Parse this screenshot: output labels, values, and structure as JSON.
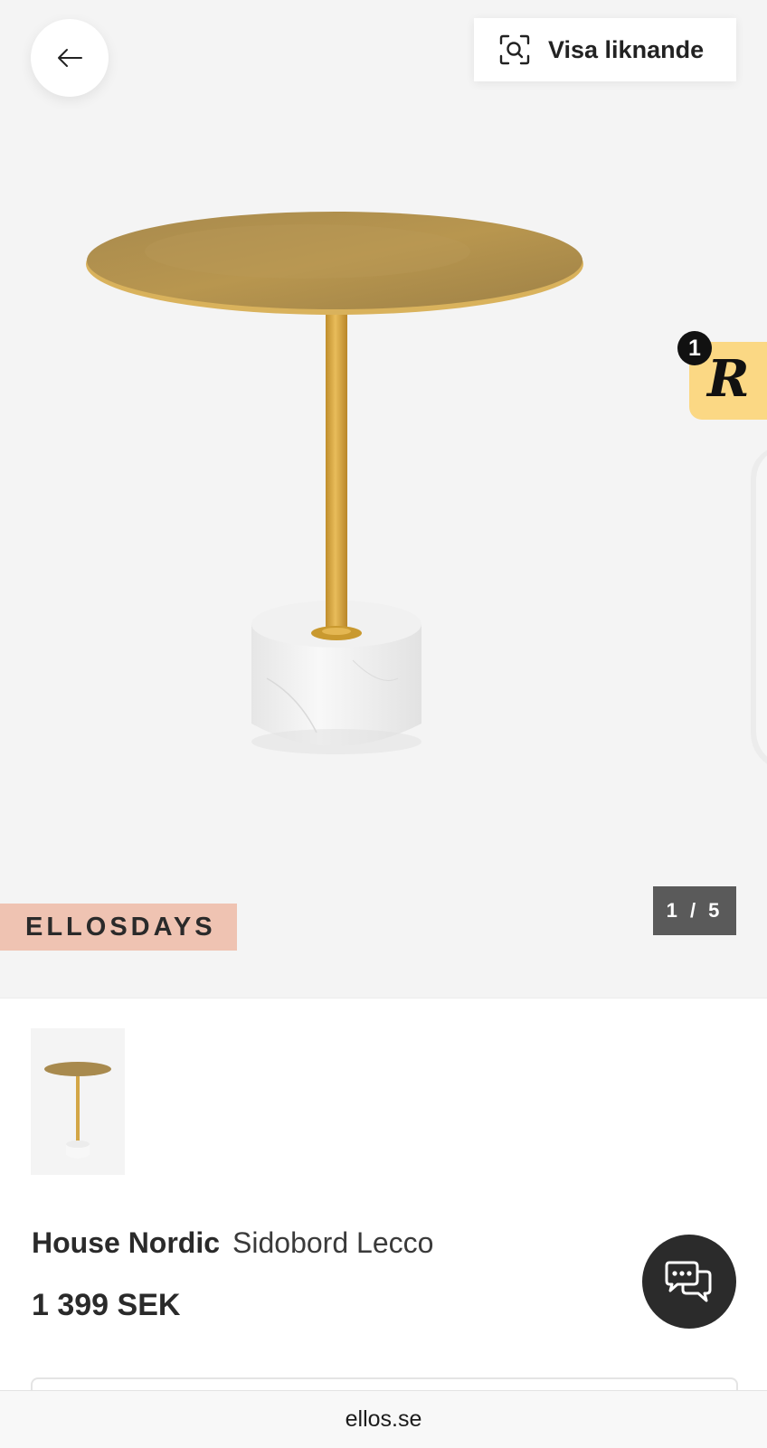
{
  "header": {
    "back_icon": "arrow-left-icon",
    "similar_label": "Visa liknande",
    "similar_icon": "visual-search-icon"
  },
  "gallery": {
    "promo_label": "ELLOSDAYS",
    "counter": "1 / 5",
    "current_image": 1,
    "total_images": 5
  },
  "reward_widget": {
    "letter": "R",
    "count": "1",
    "color": "#fbd884"
  },
  "product": {
    "brand": "House Nordic",
    "name": "Sidobord Lecco",
    "price": "1 399 SEK"
  },
  "chat": {
    "icon": "chat-bubbles-icon"
  },
  "browser": {
    "url": "ellos.se"
  },
  "colors": {
    "gallery_bg": "#f4f4f4",
    "promo_bg": "#efc3b2",
    "counter_bg": "#5a5a5a",
    "chat_bg": "#2b2b2b"
  }
}
